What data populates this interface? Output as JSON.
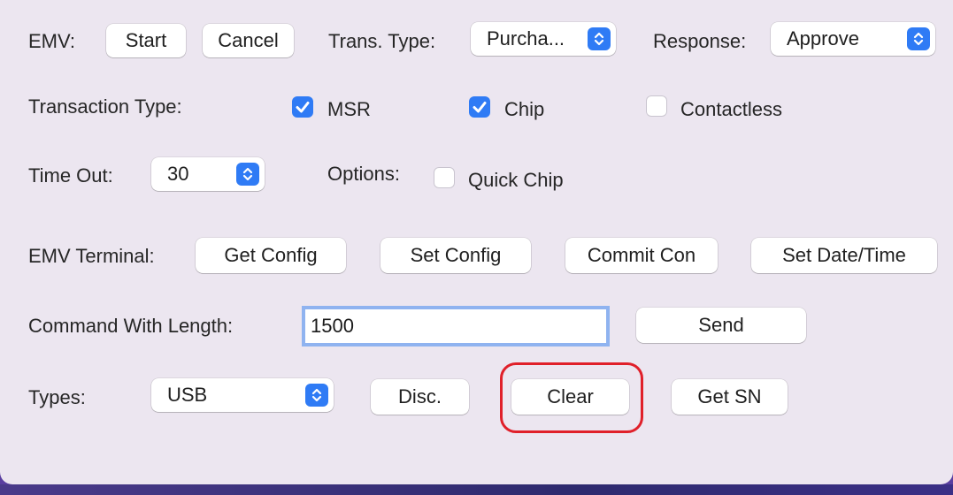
{
  "emv_row": {
    "label": "EMV:",
    "start_label": "Start",
    "cancel_label": "Cancel",
    "trans_type_label": "Trans. Type:",
    "trans_type_value": "Purcha...",
    "response_label": "Response:",
    "response_value": "Approve"
  },
  "transaction_type_row": {
    "label": "Transaction Type:",
    "options": [
      {
        "label": "MSR",
        "checked": true
      },
      {
        "label": "Chip",
        "checked": true
      },
      {
        "label": "Contactless",
        "checked": false
      }
    ]
  },
  "timeout_row": {
    "label": "Time Out:",
    "value": "30",
    "options_label": "Options:",
    "quick_chip_label": "Quick Chip",
    "quick_chip_checked": false
  },
  "terminal_row": {
    "label": "EMV Terminal:",
    "buttons": [
      "Get Config",
      "Set Config",
      "Commit Con",
      "Set Date/Time"
    ]
  },
  "command_row": {
    "label": "Command With Length:",
    "input_value": "1500",
    "send_label": "Send"
  },
  "types_row": {
    "label": "Types:",
    "value": "USB",
    "disc_label": "Disc.",
    "clear_label": "Clear",
    "get_sn_label": "Get SN"
  },
  "colors": {
    "accent": "#2f7bf5",
    "highlight": "#e0202a",
    "panel": "#ece6f0"
  }
}
